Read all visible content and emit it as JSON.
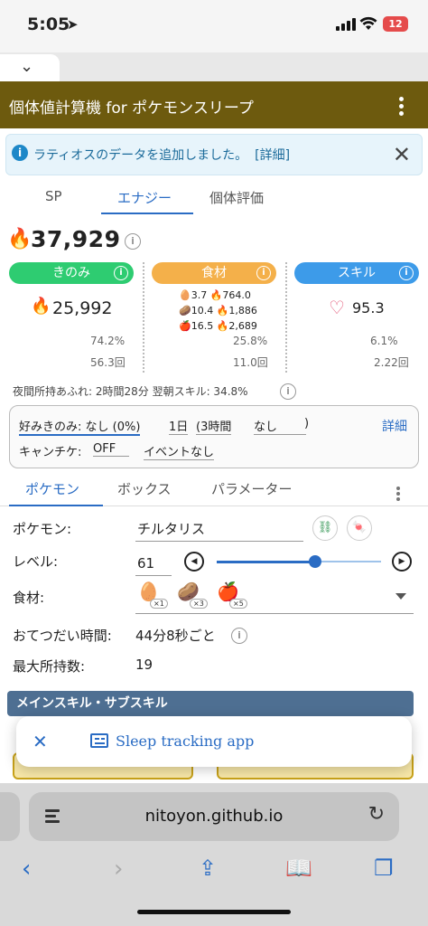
{
  "status_bar": {
    "time": "5:05",
    "battery": "12"
  },
  "app": {
    "title": "個体値計算機 for ポケモンスリープ"
  },
  "alert": {
    "message": "ラティオスのデータを追加しました。",
    "link": "[詳細]"
  },
  "main_tabs": [
    {
      "label": "SP",
      "active": false
    },
    {
      "label": "エナジー",
      "active": true
    },
    {
      "label": "個体評価",
      "active": false
    }
  ],
  "energy": {
    "total": "37,929",
    "berry": {
      "label": "きのみ",
      "value": "25,992",
      "pct": "74.2%",
      "times": "56.3回",
      "color": "#2ecc71"
    },
    "ingredient": {
      "label": "食材",
      "rows": [
        {
          "icon": "egg-icon",
          "count": "3.7",
          "energy": "764.0"
        },
        {
          "icon": "potato-icon",
          "count": "10.4",
          "energy": "1,886"
        },
        {
          "icon": "apple-icon",
          "count": "16.5",
          "energy": "2,689"
        }
      ],
      "pct": "25.8%",
      "times": "11.0回",
      "color": "#f4b04a"
    },
    "skill": {
      "label": "スキル",
      "value": "95.3",
      "pct": "6.1%",
      "times": "2.22回",
      "color": "#3d9be9"
    }
  },
  "status_line": "夜間所持あふれ: 2時間28分  翌朝スキル: 34.8%",
  "settings": {
    "favorite": "好みきのみ: なし (0%)",
    "day": "1日",
    "hours": "(3時間",
    "none": "なし",
    "paren": ")",
    "detail": "詳細",
    "camp": "キャンチケ:",
    "camp_val": "OFF",
    "event": "イベントなし"
  },
  "sub_tabs": [
    {
      "label": "ポケモン",
      "active": true
    },
    {
      "label": "ボックス",
      "active": false
    },
    {
      "label": "パラメーター",
      "active": false
    }
  ],
  "form": {
    "pokemon_label": "ポケモン:",
    "pokemon_value": "チルタリス",
    "level_label": "レベル:",
    "level_value": "61",
    "level_fraction": 0.6,
    "ingredients_label": "食材:",
    "ingredients": [
      {
        "icon": "egg-icon",
        "qty": "×1"
      },
      {
        "icon": "potato-icon",
        "qty": "×3"
      },
      {
        "icon": "apple-icon",
        "qty": "×5"
      }
    ],
    "help_time_label": "おてつだい時間:",
    "help_time_value": "44分8秒ごと",
    "max_carry_label": "最大所持数:",
    "max_carry_value": "19"
  },
  "section_title": "メインスキル・サブスキル",
  "banner": {
    "text": "Sleep tracking app"
  },
  "browser": {
    "url": "nitoyon.github.io"
  }
}
